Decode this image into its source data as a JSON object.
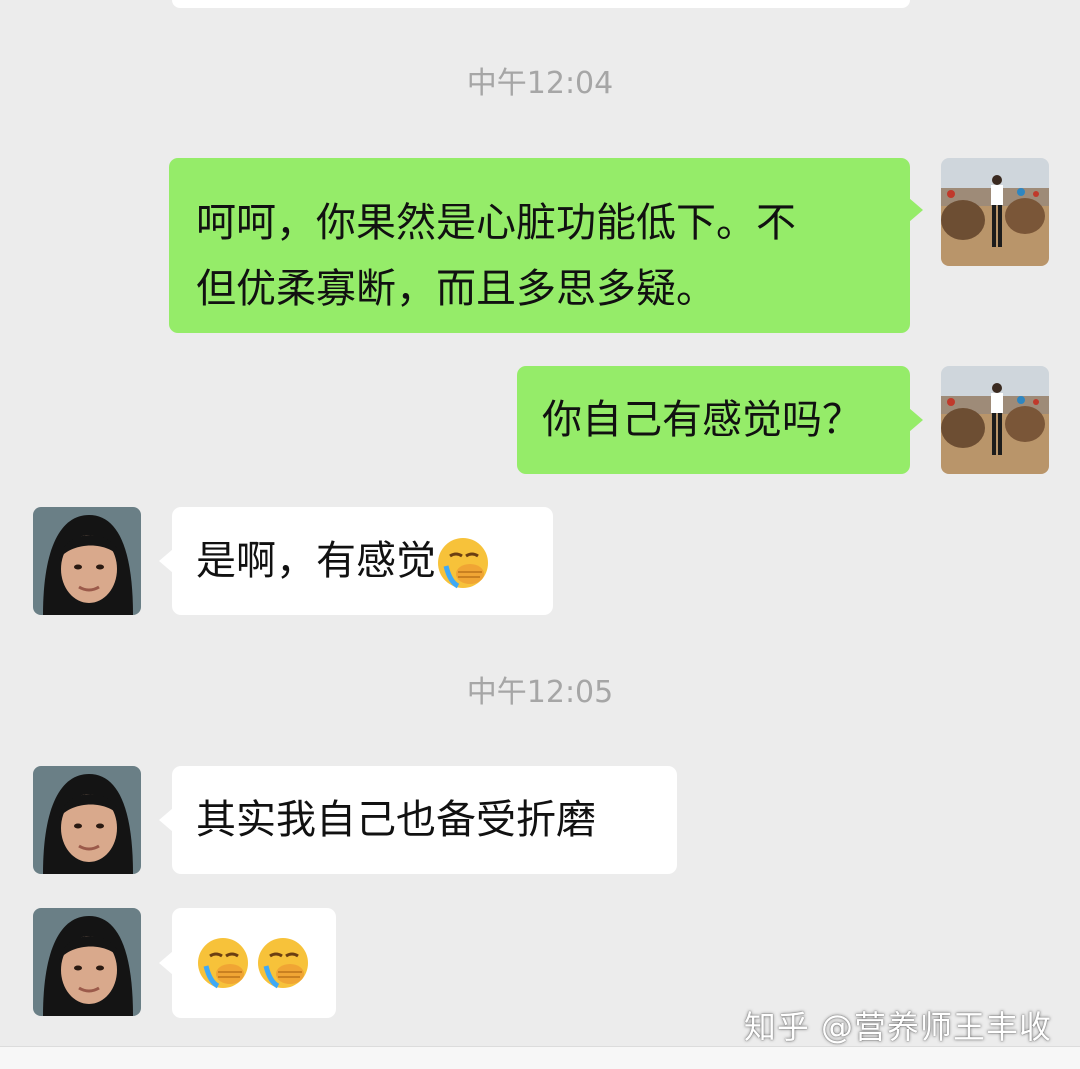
{
  "chat": {
    "timestamps": [
      "中午12:04",
      "中午12:05"
    ],
    "messages": [
      {
        "sender": "self",
        "text_lines": [
          "呵呵，你果然是心脏功能低下。不",
          "但优柔寡断，而且多思多疑。"
        ]
      },
      {
        "sender": "self",
        "text": "你自己有感觉吗？"
      },
      {
        "sender": "other",
        "text": "是啊，有感觉",
        "emoji": "face-palm-crying-emoji"
      },
      {
        "sender": "other",
        "text": "其实我自己也备受折磨"
      },
      {
        "sender": "other",
        "emoji_count": 2,
        "emoji": "face-palm-crying-emoji"
      }
    ]
  },
  "watermark": "知乎 @营养师王丰收",
  "colors": {
    "background": "#ececec",
    "self_bubble": "#95ec69",
    "other_bubble": "#ffffff",
    "timestamp_text": "#a6a6a6"
  },
  "icons": {
    "self_avatar": "man-in-desert-avatar",
    "other_avatar": "woman-portrait-avatar"
  }
}
